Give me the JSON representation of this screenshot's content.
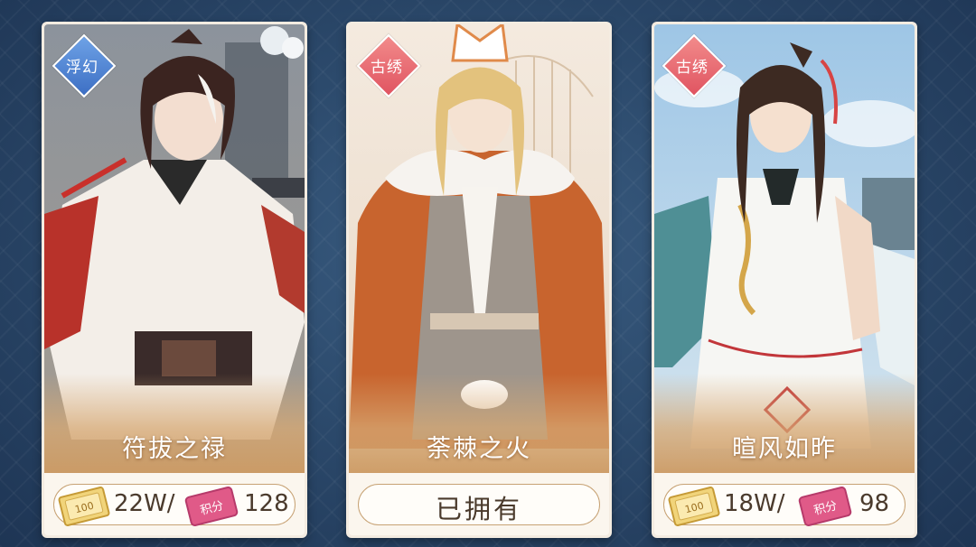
{
  "cards": [
    {
      "name": "符拔之禄",
      "tag": "浮幻",
      "tag_color": "blue",
      "price_currency": "22W/",
      "price_points": "128",
      "ticket_label": "100",
      "points_label": "积分",
      "owned": false
    },
    {
      "name": "荼棘之火",
      "tag": "古绣",
      "tag_color": "red",
      "owned": true,
      "owned_label": "已拥有"
    },
    {
      "name": "暄风如昨",
      "tag": "古绣",
      "tag_color": "red",
      "price_currency": "18W/",
      "price_points": "98",
      "ticket_label": "100",
      "points_label": "积分",
      "owned": false
    }
  ],
  "colors": {
    "tag_blue": "#4f85d6",
    "tag_red": "#e9656f",
    "pill_border": "#c7a274",
    "text_dark": "#4a3a2c"
  }
}
